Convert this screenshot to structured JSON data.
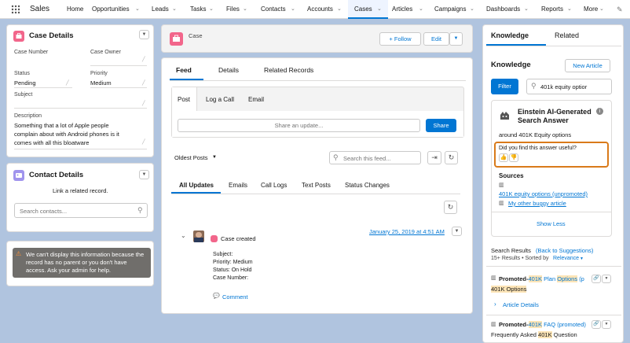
{
  "app": {
    "name": "Sales"
  },
  "nav": {
    "items": [
      "Home",
      "Opportunities",
      "Leads",
      "Tasks",
      "Files",
      "Contacts",
      "Accounts",
      "Cases",
      "Articles",
      "Campaigns",
      "Dashboards",
      "Reports",
      "More"
    ]
  },
  "case_details": {
    "title": "Case Details",
    "fields": {
      "case_number_label": "Case Number",
      "case_owner_label": "Case Owner",
      "status_label": "Status",
      "status_value": "Pending",
      "priority_label": "Priority",
      "priority_value": "Medium",
      "subject_label": "Subject",
      "description_label": "Description",
      "description_lines": [
        "Something that a lot of Apple people",
        "complain about with Android phones is it",
        "comes with all this bloatware"
      ]
    }
  },
  "contact_details": {
    "title": "Contact Details",
    "link_text": "Link a related record.",
    "search_placeholder": "Search contacts..."
  },
  "warning": {
    "lines": [
      "We can't display this information because the",
      "record has no parent or you don't have",
      "access. Ask your admin for help."
    ]
  },
  "case_header": {
    "label": "Case",
    "follow": "+ Follow",
    "edit": "Edit"
  },
  "feed_tabs": [
    "Feed",
    "Details",
    "Related Records"
  ],
  "publisher": {
    "tabs": [
      "Post",
      "Log a Call",
      "Email"
    ],
    "share_placeholder": "Share an update...",
    "share_button": "Share"
  },
  "feed_controls": {
    "sort": "Oldest Posts",
    "search_placeholder": "Search this feed..."
  },
  "feed_filters": [
    "All Updates",
    "Emails",
    "Call Logs",
    "Text Posts",
    "Status Changes"
  ],
  "feed_item": {
    "timestamp": "January 25, 2019 at 4:51 AM",
    "title": "Case created",
    "fields": [
      "Subject:",
      "Priority: Medium",
      "Status: On Hold",
      "Case Number:"
    ],
    "comment": "Comment"
  },
  "right_tabs": [
    "Knowledge",
    "Related"
  ],
  "knowledge": {
    "title": "Knowledge",
    "new_article": "New Article",
    "filter": "Filter",
    "search_value": "401k equity optior",
    "einstein_title_1": "Einstein AI-Generated",
    "einstein_title_2": "Search Answer",
    "answer_text": "around 401K Equity options",
    "feedback_question": "Did you find this answer useful?",
    "sources_label": "Sources",
    "sources": [
      "401K equity options (unpromoted)",
      "My other buggy article"
    ],
    "show_less": "Show Less",
    "results_label": "Search Results",
    "back_link": "(Back to Suggestions)",
    "results_count": "15+ Results • Sorted by",
    "sorted_by": "Relevance",
    "result1_prefix": "Promoted-",
    "result1_hl1": "401K",
    "result1_mid": "Plan",
    "result1_hl2": "Options",
    "result1_suffix": "(p",
    "result1_sub": "401K Options",
    "article_details": "Article Details",
    "result2_prefix": "Promoted-",
    "result2_hl": "401K",
    "result2_rest": "FAQ (promoted)",
    "result2_sub_pre": "Frequently Asked",
    "result2_sub_hl": "401K",
    "result2_sub_post": "Question"
  },
  "colors": {
    "accent": "#0176d3",
    "case_icon": "#f2668b",
    "contact_icon": "#a094ed",
    "highlight_box": "#d97a1a"
  }
}
